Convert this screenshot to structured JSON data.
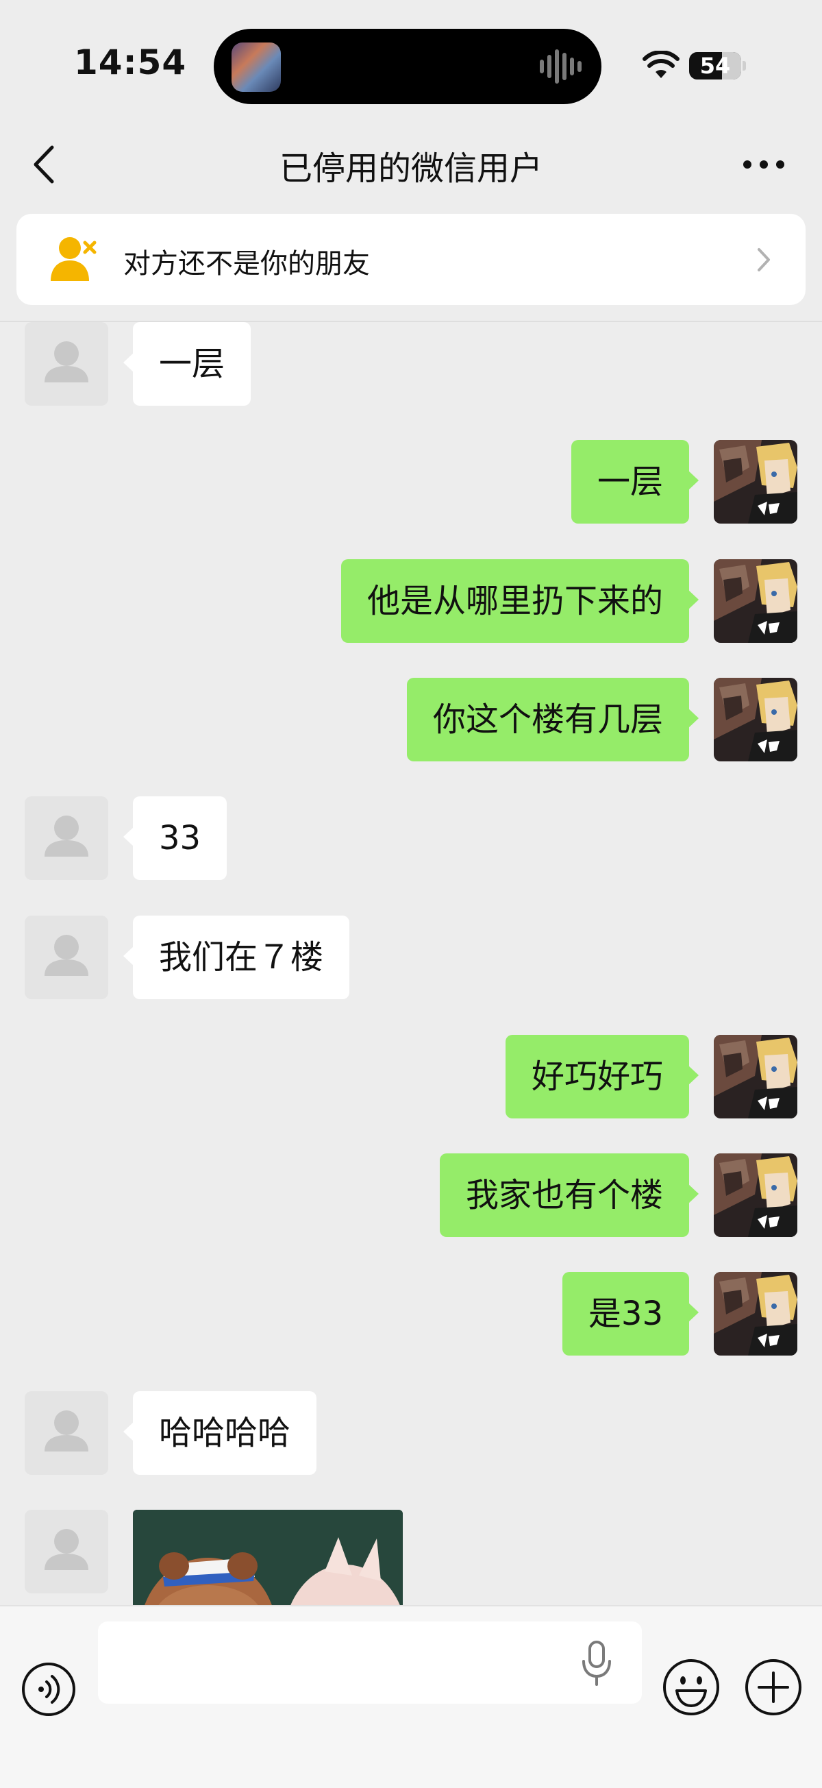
{
  "status_bar": {
    "time": "14:54",
    "battery": "54"
  },
  "nav": {
    "title": "已停用的微信用户"
  },
  "banner": {
    "text": "对方还不是你的朋友"
  },
  "messages": [
    {
      "side": "in",
      "text": "一层"
    },
    {
      "side": "out",
      "text": "一层"
    },
    {
      "side": "out",
      "text": "他是从哪里扔下来的"
    },
    {
      "side": "out",
      "text": "你这个楼有几层"
    },
    {
      "side": "in",
      "text": "33"
    },
    {
      "side": "in",
      "text": "我们在７楼"
    },
    {
      "side": "out",
      "text": "好巧好巧"
    },
    {
      "side": "out",
      "text": "我家也有个楼"
    },
    {
      "side": "out",
      "text": "是33"
    },
    {
      "side": "in",
      "text": "哈哈哈哈"
    },
    {
      "side": "in",
      "type": "sticker"
    }
  ],
  "input": {
    "value": "",
    "placeholder": ""
  },
  "icons": {
    "back": "chevron-left-icon",
    "more": "more-dots-icon",
    "friend": "person-remove-icon",
    "chevron": "chevron-right-icon",
    "voice": "voice-mode-icon",
    "mic": "microphone-icon",
    "emoji": "emoji-icon",
    "plus": "plus-circle-icon"
  },
  "colors": {
    "background": "#ededed",
    "outgoing_bubble": "#95ec69",
    "incoming_bubble": "#ffffff",
    "friend_icon": "#f5b500"
  }
}
